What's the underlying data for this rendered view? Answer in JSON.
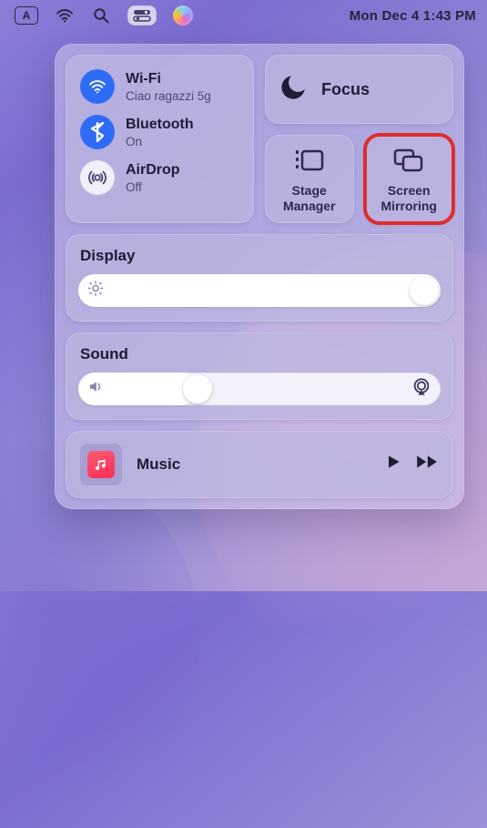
{
  "menubar": {
    "language_label": "A",
    "datetime": "Mon Dec 4  1:43 PM"
  },
  "network": {
    "wifi": {
      "title": "Wi-Fi",
      "sub": "Ciao ragazzi 5g",
      "on": true
    },
    "bluetooth": {
      "title": "Bluetooth",
      "sub": "On",
      "on": true
    },
    "airdrop": {
      "title": "AirDrop",
      "sub": "Off",
      "on": false
    }
  },
  "focus": {
    "label": "Focus"
  },
  "tiles": {
    "stage_manager": {
      "label": "Stage\nManager"
    },
    "screen_mirroring": {
      "label": "Screen\nMirroring",
      "highlighted": true
    }
  },
  "display": {
    "title": "Display",
    "value_pct": 100
  },
  "sound": {
    "title": "Sound",
    "value_pct": 33
  },
  "music": {
    "title": "Music"
  }
}
